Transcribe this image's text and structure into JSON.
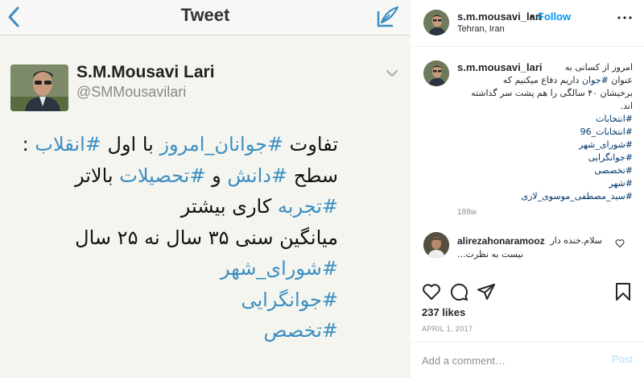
{
  "tweet_screenshot": {
    "nav_title": "Tweet",
    "icons": {
      "back": "chevron-left-icon",
      "compose": "compose-tweet-icon",
      "caret": "chevron-down-icon"
    },
    "author_name": "S.M.Mousavi Lari",
    "author_handle": "@SMMousavilari",
    "body_lines": [
      {
        "parts": [
          {
            "t": "تفاوت ",
            "tag": false
          },
          {
            "t": "#جوانان_امروز",
            "tag": true
          },
          {
            "t": " با اول ",
            "tag": false
          },
          {
            "t": "#انقلاب",
            "tag": true
          },
          {
            "t": " :",
            "tag": false
          }
        ]
      },
      {
        "parts": [
          {
            "t": "سطح ",
            "tag": false
          },
          {
            "t": "#دانش",
            "tag": true
          },
          {
            "t": " و ",
            "tag": false
          },
          {
            "t": "#تحصیلات",
            "tag": true
          },
          {
            "t": " بالاتر",
            "tag": false
          }
        ]
      },
      {
        "parts": [
          {
            "t": "#تجربه",
            "tag": true
          },
          {
            "t": " کاری بیشتر",
            "tag": false
          }
        ]
      },
      {
        "parts": [
          {
            "t": "میانگین سنی ۳۵ سال نه ۲۵ سال",
            "tag": false
          }
        ]
      },
      {
        "parts": [
          {
            "t": "#شورای_شهر",
            "tag": true
          }
        ]
      },
      {
        "parts": [
          {
            "t": "#جوانگرایی",
            "tag": true
          }
        ]
      },
      {
        "parts": [
          {
            "t": "#تخصص",
            "tag": true
          }
        ]
      }
    ],
    "colors": {
      "hashtag": "#3b8ec2",
      "background": "#f5f5f0"
    }
  },
  "instagram": {
    "header": {
      "username": "s.m.mousavi_lari",
      "dot": "•",
      "follow_label": "Follow",
      "location": "Tehran, Iran",
      "more_icon": "more-horizontal-icon"
    },
    "caption": {
      "username": "s.m.mousavi_lari",
      "lines": [
        {
          "parts": [
            {
              "t": "امروز از کسانی به",
              "tag": false
            }
          ]
        },
        {
          "parts": [
            {
              "t": "عنوان ",
              "tag": false
            },
            {
              "t": "#جوان",
              "tag": true
            },
            {
              "t": " داریم دفاع میکنیم که",
              "tag": false
            }
          ]
        },
        {
          "parts": [
            {
              "t": "برخیشان ۴۰ سالگی را هم پشت سر گذاشته",
              "tag": false
            }
          ]
        },
        {
          "parts": [
            {
              "t": "اند.",
              "tag": false
            }
          ]
        },
        {
          "parts": [
            {
              "t": "#انتخابات",
              "tag": true
            }
          ]
        },
        {
          "parts": [
            {
              "t": "#انتخابات_96",
              "tag": true
            }
          ]
        },
        {
          "parts": [
            {
              "t": "#شورای_شهر",
              "tag": true
            }
          ]
        },
        {
          "parts": [
            {
              "t": "#جوانگرایی",
              "tag": true
            }
          ]
        },
        {
          "parts": [
            {
              "t": "#تخصصی",
              "tag": true
            }
          ]
        },
        {
          "parts": [
            {
              "t": "#شهر",
              "tag": true
            }
          ]
        },
        {
          "parts": [
            {
              "t": "#سید_مصطفی_موسوی_لاری",
              "tag": true
            }
          ]
        }
      ],
      "time": "188w"
    },
    "comment": {
      "username": "alirezahonaramooz",
      "line1": "سلام.خنده دار",
      "line2": "نیست به نظرت...",
      "heart_icon": "heart-outline-icon"
    },
    "actions": {
      "like_icon": "heart-icon",
      "comment_icon": "comment-icon",
      "share_icon": "share-icon",
      "save_icon": "bookmark-icon"
    },
    "likes": "237 likes",
    "date": "APRIL 1, 2017",
    "add_comment_placeholder": "Add a comment…",
    "post_label": "Post",
    "colors": {
      "link": "#0095f6",
      "hashtag": "#00376b",
      "muted": "#8e8e8e"
    }
  }
}
